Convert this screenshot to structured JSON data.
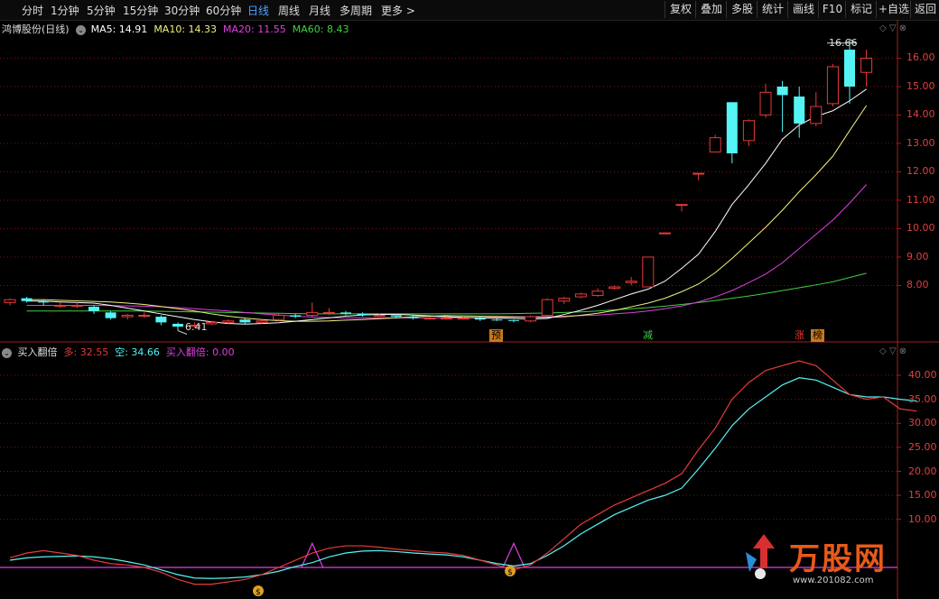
{
  "toolbar": {
    "periods": [
      "分时",
      "1分钟",
      "5分钟",
      "15分钟",
      "30分钟",
      "60分钟",
      "日线",
      "周线",
      "月线",
      "多周期",
      "更多"
    ],
    "active": "日线",
    "buttons": [
      "复权",
      "叠加",
      "多股",
      "统计",
      "画线",
      "F10",
      "标记",
      "+自选",
      "返回"
    ]
  },
  "main": {
    "stock": "鸿博股份",
    "period_label": "(日线)",
    "ma5": "MA5: 14.91",
    "ma10": "MA10: 14.33",
    "ma20": "MA20: 11.55",
    "ma60": "MA60: 8.43",
    "high_label": "16.66",
    "low_label": "6.41",
    "signal_yu": "预",
    "signal_jian": "减",
    "signal_zhang": "涨",
    "signal_bang": "榜",
    "y_ticks": [
      "16.00",
      "15.00",
      "14.00",
      "13.00",
      "12.00",
      "11.00",
      "10.00",
      "9.00",
      "8.00"
    ]
  },
  "sub": {
    "name": "买入翻倍",
    "duo": "多: 32.55",
    "kong": "空: 34.66",
    "buy": "买入翻倍: 0.00",
    "y_ticks": [
      "40.00",
      "35.00",
      "30.00",
      "25.00",
      "20.00",
      "15.00",
      "10.00"
    ]
  },
  "watermark": {
    "brand": "万股网",
    "site": "www.201082.com"
  },
  "colors": {
    "up": "#e83a3a",
    "down": "#54f4f4",
    "ma5": "#ffffff",
    "ma10": "#f0f080",
    "ma20": "#e040e0",
    "ma60": "#40d040",
    "grid": "#7a1515",
    "axis": "#a02020",
    "active_tab": "#4ea2ff"
  },
  "chart_data": {
    "type": "candlestick",
    "price_range": [
      6.0,
      17.0
    ],
    "candles": [
      {
        "o": 7.4,
        "c": 7.5,
        "h": 7.55,
        "l": 7.3
      },
      {
        "o": 7.55,
        "c": 7.45,
        "h": 7.6,
        "l": 7.4
      },
      {
        "o": 7.45,
        "c": 7.4,
        "h": 7.5,
        "l": 7.3
      },
      {
        "o": 7.3,
        "c": 7.3,
        "h": 7.4,
        "l": 7.2
      },
      {
        "o": 7.3,
        "c": 7.3,
        "h": 7.4,
        "l": 7.2
      },
      {
        "o": 7.25,
        "c": 7.1,
        "h": 7.3,
        "l": 7.0
      },
      {
        "o": 7.05,
        "c": 6.85,
        "h": 7.1,
        "l": 6.8
      },
      {
        "o": 6.9,
        "c": 6.95,
        "h": 7.0,
        "l": 6.8
      },
      {
        "o": 6.95,
        "c": 6.95,
        "h": 7.05,
        "l": 6.85
      },
      {
        "o": 6.9,
        "c": 6.7,
        "h": 6.95,
        "l": 6.6
      },
      {
        "o": 6.65,
        "c": 6.55,
        "h": 6.7,
        "l": 6.41
      },
      {
        "o": 6.6,
        "c": 6.6,
        "h": 6.7,
        "l": 6.5
      },
      {
        "o": 6.65,
        "c": 6.7,
        "h": 6.75,
        "l": 6.6
      },
      {
        "o": 6.7,
        "c": 6.75,
        "h": 6.8,
        "l": 6.65
      },
      {
        "o": 6.8,
        "c": 6.7,
        "h": 6.85,
        "l": 6.65
      },
      {
        "o": 6.7,
        "c": 6.75,
        "h": 6.8,
        "l": 6.65
      },
      {
        "o": 6.8,
        "c": 6.95,
        "h": 7.0,
        "l": 6.75
      },
      {
        "o": 6.95,
        "c": 6.9,
        "h": 7.0,
        "l": 6.85
      },
      {
        "o": 6.95,
        "c": 7.05,
        "h": 7.4,
        "l": 6.9
      },
      {
        "o": 7.05,
        "c": 7.05,
        "h": 7.2,
        "l": 6.95
      },
      {
        "o": 7.05,
        "c": 7.0,
        "h": 7.1,
        "l": 6.95
      },
      {
        "o": 7.0,
        "c": 6.95,
        "h": 7.05,
        "l": 6.9
      },
      {
        "o": 6.95,
        "c": 6.95,
        "h": 7.0,
        "l": 6.9
      },
      {
        "o": 6.95,
        "c": 6.9,
        "h": 7.0,
        "l": 6.85
      },
      {
        "o": 6.9,
        "c": 6.85,
        "h": 6.95,
        "l": 6.8
      },
      {
        "o": 6.85,
        "c": 6.85,
        "h": 6.9,
        "l": 6.8
      },
      {
        "o": 6.85,
        "c": 6.85,
        "h": 6.9,
        "l": 6.8
      },
      {
        "o": 6.85,
        "c": 6.85,
        "h": 6.9,
        "l": 6.8
      },
      {
        "o": 6.85,
        "c": 6.8,
        "h": 6.9,
        "l": 6.75
      },
      {
        "o": 6.8,
        "c": 6.78,
        "h": 6.85,
        "l": 6.75
      },
      {
        "o": 6.78,
        "c": 6.75,
        "h": 6.8,
        "l": 6.7
      },
      {
        "o": 6.75,
        "c": 6.9,
        "h": 6.95,
        "l": 6.7
      },
      {
        "o": 6.95,
        "c": 7.5,
        "h": 7.55,
        "l": 6.9
      },
      {
        "o": 7.45,
        "c": 7.55,
        "h": 7.6,
        "l": 7.35
      },
      {
        "o": 7.6,
        "c": 7.7,
        "h": 7.75,
        "l": 7.55
      },
      {
        "o": 7.65,
        "c": 7.8,
        "h": 7.9,
        "l": 7.6
      },
      {
        "o": 7.9,
        "c": 7.95,
        "h": 8.0,
        "l": 7.85
      },
      {
        "o": 8.1,
        "c": 8.15,
        "h": 8.3,
        "l": 8.0
      },
      {
        "o": 7.95,
        "c": 9.0,
        "h": 9.0,
        "l": 7.95
      },
      {
        "o": 9.85,
        "c": 9.85,
        "h": 9.85,
        "l": 9.85
      },
      {
        "o": 10.85,
        "c": 10.85,
        "h": 10.85,
        "l": 10.6
      },
      {
        "o": 11.95,
        "c": 11.95,
        "h": 11.95,
        "l": 11.7
      },
      {
        "o": 12.7,
        "c": 13.2,
        "h": 13.3,
        "l": 12.7
      },
      {
        "o": 14.45,
        "c": 12.65,
        "h": 14.45,
        "l": 12.3
      },
      {
        "o": 13.1,
        "c": 13.8,
        "h": 13.85,
        "l": 12.9
      },
      {
        "o": 14.0,
        "c": 14.8,
        "h": 15.1,
        "l": 13.9
      },
      {
        "o": 15.0,
        "c": 14.7,
        "h": 15.2,
        "l": 13.4
      },
      {
        "o": 14.65,
        "c": 13.7,
        "h": 15.0,
        "l": 13.2
      },
      {
        "o": 13.7,
        "c": 14.3,
        "h": 14.8,
        "l": 13.6
      },
      {
        "o": 14.4,
        "c": 15.7,
        "h": 15.8,
        "l": 14.3
      },
      {
        "o": 16.3,
        "c": 15.0,
        "h": 16.66,
        "l": 14.4
      },
      {
        "o": 15.5,
        "c": 16.0,
        "h": 16.3,
        "l": 15.0
      }
    ],
    "ma5": [
      7.45,
      7.45,
      7.42,
      7.4,
      7.38,
      7.3,
      7.2,
      7.1,
      7.0,
      6.9,
      6.8,
      6.72,
      6.66,
      6.64,
      6.66,
      6.69,
      6.74,
      6.8,
      6.86,
      6.92,
      6.96,
      6.98,
      6.98,
      6.96,
      6.93,
      6.9,
      6.88,
      6.86,
      6.85,
      6.84,
      6.82,
      6.84,
      6.98,
      7.13,
      7.3,
      7.5,
      7.7,
      7.87,
      8.15,
      8.6,
      9.1,
      9.9,
      10.85,
      11.55,
      12.3,
      13.15,
      13.65,
      13.95,
      14.15,
      14.5,
      14.91
    ],
    "ma10": [
      7.5,
      7.5,
      7.48,
      7.46,
      7.44,
      7.42,
      7.38,
      7.33,
      7.26,
      7.18,
      7.1,
      7.0,
      6.92,
      6.85,
      6.8,
      6.76,
      6.74,
      6.74,
      6.75,
      6.78,
      6.8,
      6.83,
      6.86,
      6.9,
      6.92,
      6.94,
      6.93,
      6.92,
      6.91,
      6.9,
      6.88,
      6.88,
      6.9,
      6.95,
      7.02,
      7.12,
      7.25,
      7.38,
      7.55,
      7.78,
      8.05,
      8.45,
      8.95,
      9.5,
      10.05,
      10.65,
      11.3,
      11.9,
      12.55,
      13.45,
      14.33
    ],
    "ma20": [
      7.3,
      7.3,
      7.3,
      7.3,
      7.3,
      7.29,
      7.28,
      7.27,
      7.25,
      7.22,
      7.18,
      7.14,
      7.1,
      7.05,
      7.0,
      6.96,
      6.92,
      6.89,
      6.87,
      6.86,
      6.86,
      6.86,
      6.86,
      6.86,
      6.86,
      6.86,
      6.87,
      6.87,
      6.88,
      6.89,
      6.9,
      6.9,
      6.92,
      6.94,
      6.96,
      7.0,
      7.04,
      7.1,
      7.18,
      7.28,
      7.42,
      7.6,
      7.82,
      8.1,
      8.4,
      8.8,
      9.3,
      9.8,
      10.3,
      10.9,
      11.55
    ],
    "ma60": [
      7.1,
      7.1,
      7.1,
      7.1,
      7.1,
      7.1,
      7.1,
      7.1,
      7.09,
      7.08,
      7.07,
      7.06,
      7.05,
      7.04,
      7.03,
      7.02,
      7.01,
      7.0,
      7.0,
      7.0,
      7.0,
      7.0,
      7.0,
      7.0,
      7.0,
      7.0,
      7.0,
      7.0,
      7.0,
      7.01,
      7.02,
      7.03,
      7.05,
      7.07,
      7.1,
      7.14,
      7.18,
      7.22,
      7.27,
      7.33,
      7.4,
      7.47,
      7.55,
      7.63,
      7.72,
      7.82,
      7.92,
      8.02,
      8.13,
      8.28,
      8.43
    ],
    "sub_range": [
      0,
      45
    ],
    "duo": [
      2,
      3,
      3.5,
      3,
      2.5,
      1.5,
      0.8,
      0.5,
      0,
      -1,
      -2.5,
      -3.5,
      -3.5,
      -3,
      -2.5,
      -1.5,
      0,
      1.5,
      3,
      4,
      4.5,
      4.5,
      4.2,
      3.8,
      3.5,
      3.2,
      3,
      2.5,
      1.5,
      0.5,
      -0.5,
      0.5,
      3,
      6,
      9,
      11,
      13,
      14.5,
      16,
      17.5,
      19.5,
      24.5,
      29,
      35,
      38.5,
      41,
      42,
      43,
      42,
      39,
      36,
      35,
      35.5,
      33,
      32.55
    ],
    "kong": [
      1.5,
      2,
      2.2,
      2.3,
      2.4,
      2.2,
      1.8,
      1.2,
      0.5,
      -0.5,
      -1.5,
      -2.2,
      -2.3,
      -2.2,
      -2,
      -1.5,
      -0.8,
      0.2,
      1,
      2.2,
      3,
      3.4,
      3.5,
      3.3,
      3,
      2.8,
      2.6,
      2.2,
      1.5,
      0.8,
      0.3,
      0.8,
      2.5,
      4.5,
      7,
      9,
      11,
      12.5,
      14,
      15,
      16.5,
      20.5,
      24.8,
      29.5,
      33,
      35.5,
      38,
      39.5,
      39,
      37.5,
      36,
      35.5,
      35.5,
      35,
      34.66
    ],
    "buy_spike_indices": [
      18,
      30
    ]
  }
}
